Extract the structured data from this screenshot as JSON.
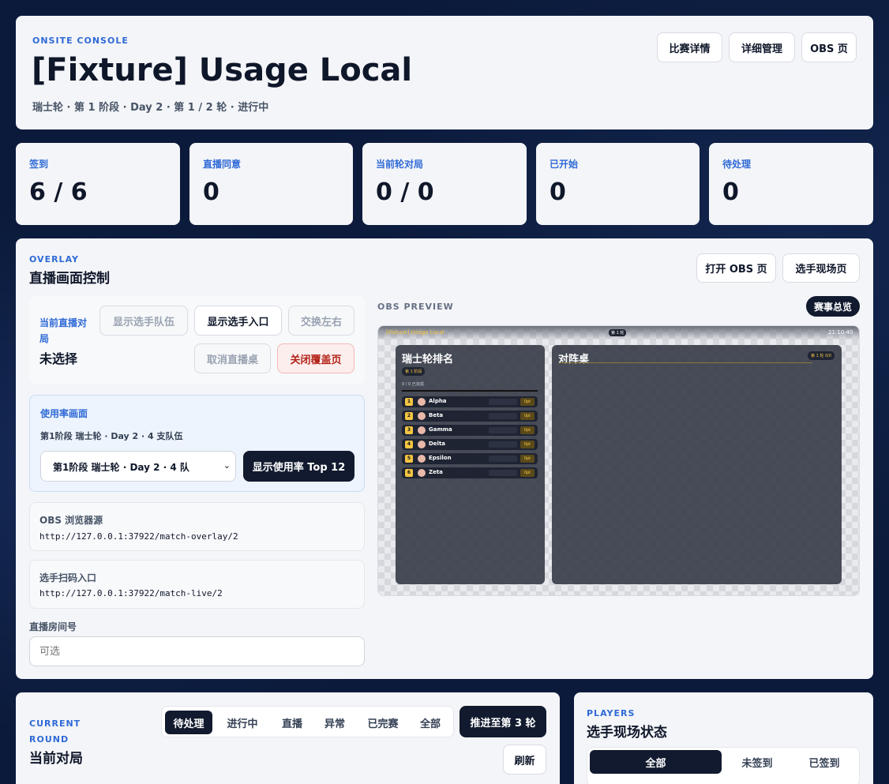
{
  "header": {
    "eyebrow": "ONSITE CONSOLE",
    "title": "[Fixture] Usage Local",
    "subtitle": "瑞士轮 · 第 1 阶段 · Day 2 · 第 1 / 2 轮 · 进行中",
    "buttons": {
      "details": "比赛详情",
      "manage": "详细管理",
      "obs": "OBS 页"
    }
  },
  "stats": [
    {
      "label": "签到",
      "value": "6 / 6"
    },
    {
      "label": "直播同意",
      "value": "0"
    },
    {
      "label": "当前轮对局",
      "value": "0 / 0"
    },
    {
      "label": "已开始",
      "value": "0"
    },
    {
      "label": "待处理",
      "value": "0"
    }
  ],
  "overlay": {
    "eyebrow": "OVERLAY",
    "title": "直播画面控制",
    "open_obs": "打开 OBS 页",
    "player_page": "选手现场页",
    "current_match_label": "当前直播对局",
    "current_match_value": "未选择",
    "actions": {
      "show_team": "显示选手队伍",
      "show_entry": "显示选手入口",
      "swap": "交换左右",
      "cancel_table": "取消直播桌",
      "close_overlay": "关闭覆盖页"
    },
    "usage": {
      "title": "使用率画面",
      "desc": "第1阶段 瑞士轮 · Day 2 · 4 支队伍",
      "select_value": "第1阶段 瑞士轮 · Day 2 · 4 队",
      "show_button": "显示使用率 Top 12"
    },
    "obs_source": {
      "label": "OBS 浏览器源",
      "url": "http://127.0.0.1:37922/match-overlay/2"
    },
    "scan_entry": {
      "label": "选手扫码入口",
      "url": "http://127.0.0.1:37922/match-live/2"
    },
    "room": {
      "label": "直播房间号",
      "placeholder": "可选"
    },
    "preview": {
      "label": "OBS PREVIEW",
      "overview_button": "赛事总览",
      "top_title": "[Fixture] Usage Local",
      "top_badge": "第 1 轮",
      "clock": "21:10:40",
      "standings_title": "瑞士轮排名",
      "standings_stage": "第 1 阶段",
      "standings_note": "0 / 0 已完成",
      "rows": [
        {
          "rank": "1",
          "name": "Alpha",
          "pts": "0pt"
        },
        {
          "rank": "2",
          "name": "Beta",
          "pts": "0pt"
        },
        {
          "rank": "3",
          "name": "Gamma",
          "pts": "0pt"
        },
        {
          "rank": "4",
          "name": "Delta",
          "pts": "0pt"
        },
        {
          "rank": "5",
          "name": "Epsilon",
          "pts": "0pt"
        },
        {
          "rank": "6",
          "name": "Zeta",
          "pts": "0pt"
        }
      ],
      "pairings_title": "对阵桌",
      "pairings_badge": "第 1 轮 0/0"
    }
  },
  "current_round": {
    "eyebrow_1": "CURRENT",
    "eyebrow_2": "ROUND",
    "title": "当前对局",
    "tabs": [
      "待处理",
      "进行中",
      "直播",
      "异常",
      "已完赛",
      "全部"
    ],
    "advance": "推进至第 3 轮",
    "refresh": "刷新"
  },
  "players": {
    "eyebrow": "PLAYERS",
    "title": "选手现场状态",
    "tabs": [
      "全部",
      "未签到",
      "已签到"
    ]
  }
}
